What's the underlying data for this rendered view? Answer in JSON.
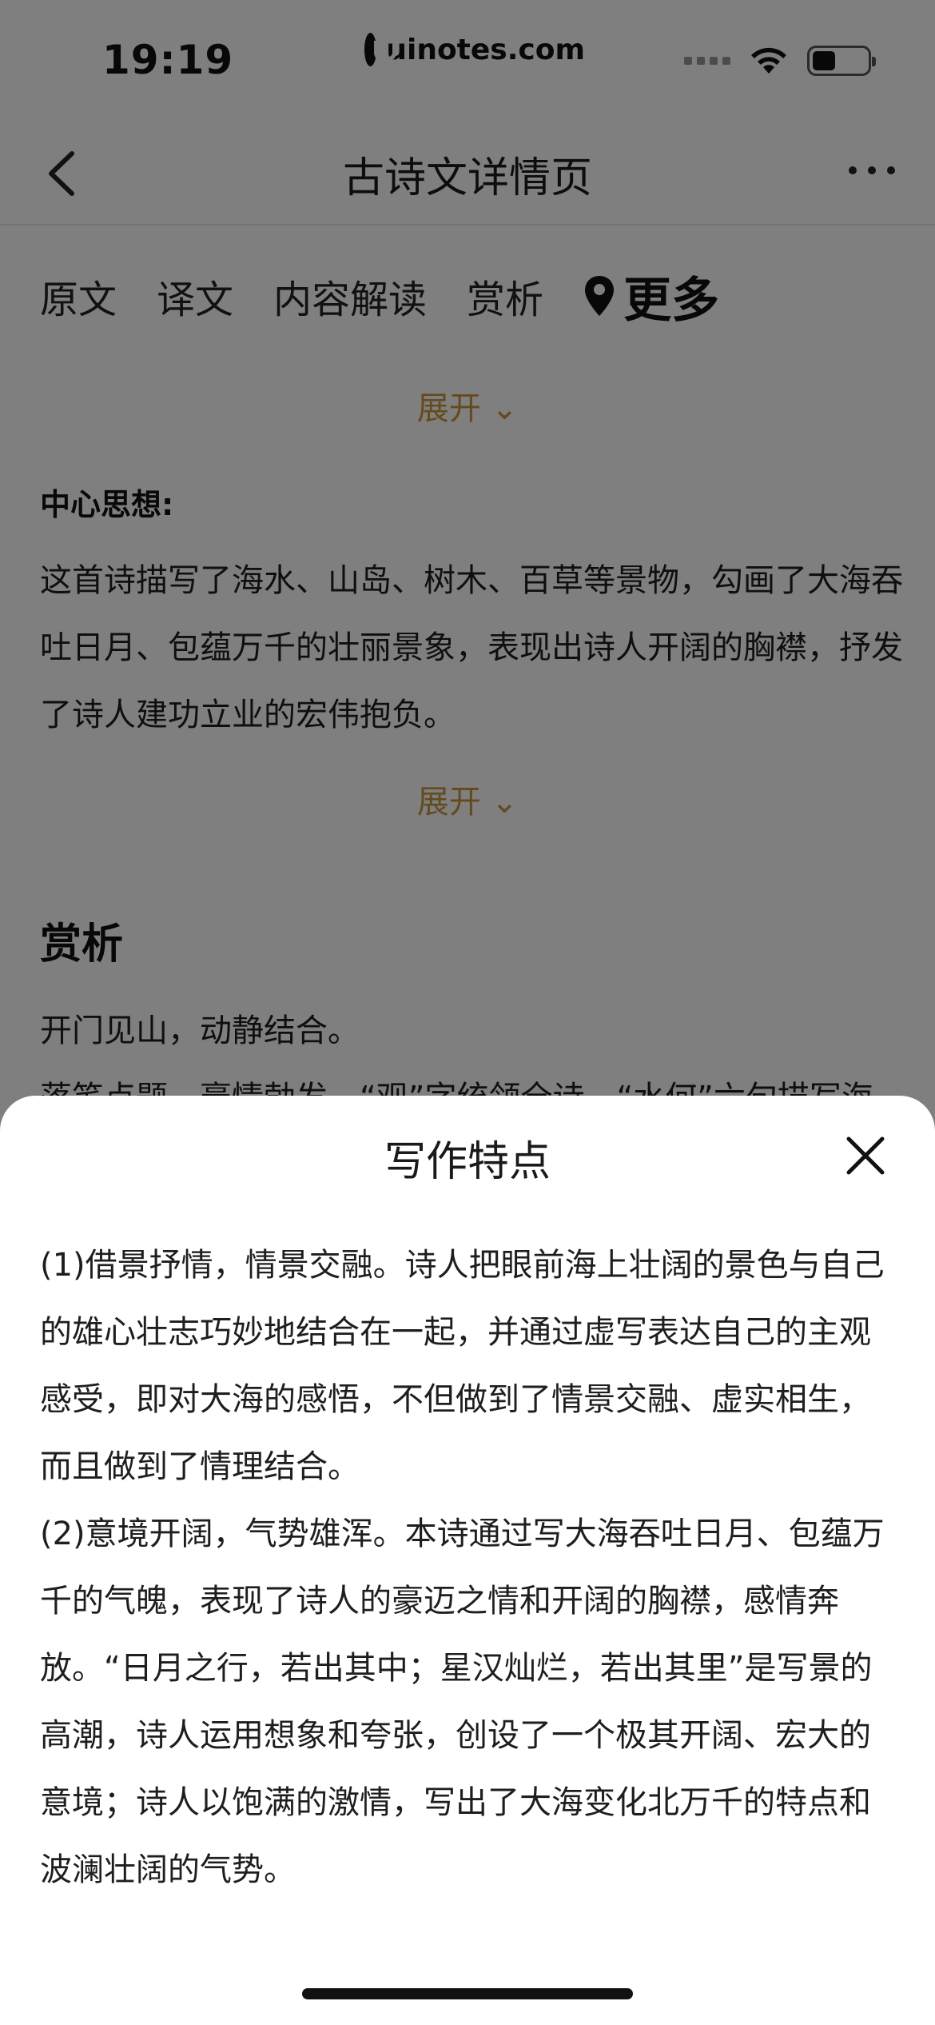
{
  "status_bar": {
    "time": "19:19",
    "watermark": "uinotes.com"
  },
  "nav": {
    "title": "古诗文详情页"
  },
  "tabs": [
    "原文",
    "译文",
    "内容解读",
    "赏析"
  ],
  "tab_more": "更多",
  "expand_label": "展开",
  "central_idea": {
    "label": "中心思想:",
    "text": "这首诗描写了海水、山岛、树木、百草等景物，勾画了大海吞吐日月、包蕴万千的壮丽景象，表现出诗人开阔的胸襟，抒发了诗人建功立业的宏伟抱负。"
  },
  "appreciation": {
    "title": "赏析",
    "line1": "开门见山，动静结合。",
    "line2": "落笔点题，豪情勃发。“观”字统领全诗。“水何”六句描写海"
  },
  "sheet": {
    "title": "写作特点",
    "paragraphs": [
      "(1)借景抒情，情景交融。诗人把眼前海上壮阔的景色与自己的雄心壮志巧妙地结合在一起，并通过虚写表达自己的主观感受，即对大海的感悟，不但做到了情景交融、虚实相生，而且做到了情理结合。",
      "(2)意境开阔，气势雄浑。本诗通过写大海吞吐日月、包蕴万千的气魄，表现了诗人的豪迈之情和开阔的胸襟，感情奔放。“日月之行，若出其中；星汉灿烂，若出其里”是写景的高潮，诗人运用想象和夸张，创设了一个极其开阔、宏大的意境；诗人以饱满的激情，写出了大海变化北万千的特点和波澜壮阔的气势。"
    ]
  },
  "colors": {
    "accent": "#c8963a",
    "overlay": "rgba(0,0,0,0.5)"
  }
}
